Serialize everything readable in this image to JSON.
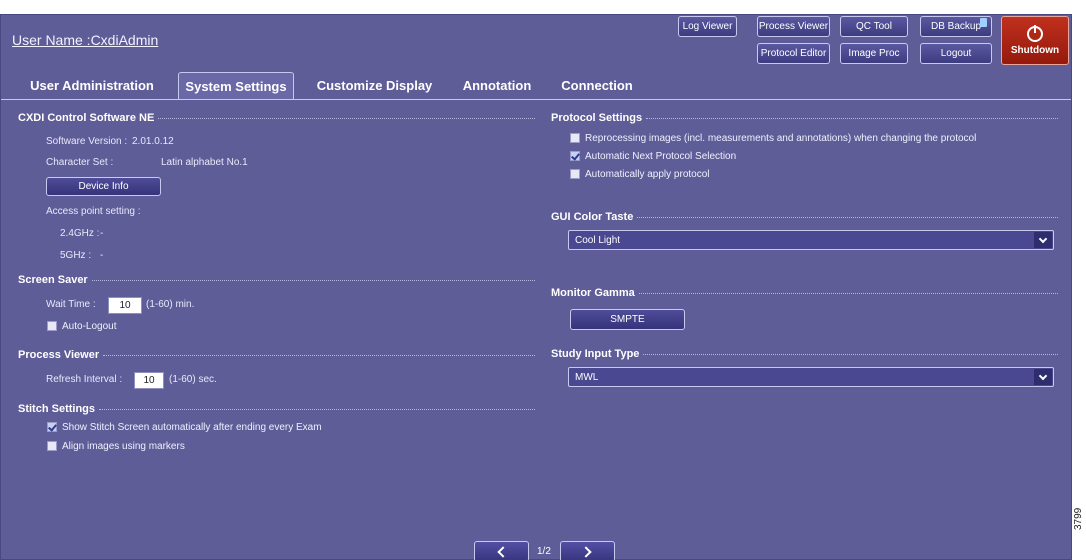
{
  "header": {
    "user_name": "User Name :CxdiAdmin",
    "buttons": {
      "log_viewer": "Log Viewer",
      "process_viewer": "Process Viewer",
      "qc_tool": "QC Tool",
      "db_backup": "DB Backup",
      "protocol_editor": "Protocol Editor",
      "image_proc": "Image Proc",
      "logout": "Logout",
      "shutdown": "Shutdown"
    }
  },
  "tabs": [
    {
      "label": "User Administration"
    },
    {
      "label": "System Settings",
      "active": true
    },
    {
      "label": "Customize Display"
    },
    {
      "label": "Annotation"
    },
    {
      "label": "Connection"
    }
  ],
  "cxdi": {
    "title": "CXDI Control Software NE",
    "software_version_label": "Software Version :",
    "software_version_value": "2.01.0.12",
    "character_set_label": "Character Set :",
    "character_set_value": "Latin alphabet No.1",
    "device_info_button": "Device Info",
    "access_point_label": "Access point setting :",
    "ghz24_label": "2.4GHz :",
    "ghz24_value": "-",
    "ghz5_label": "5GHz :",
    "ghz5_value": "-"
  },
  "screen_saver": {
    "title": "Screen Saver",
    "wait_time_label": "Wait Time :",
    "wait_time_value": "10",
    "wait_time_range": "(1-60)  min.",
    "auto_logout_label": "Auto-Logout",
    "auto_logout_checked": false
  },
  "process_viewer": {
    "title": "Process Viewer",
    "refresh_label": "Refresh Interval :",
    "refresh_value": "10",
    "refresh_range": "(1-60)  sec."
  },
  "stitch": {
    "title": "Stitch Settings",
    "show_stitch_label": "Show Stitch Screen automatically after ending every Exam",
    "show_stitch_checked": true,
    "align_label": "Align images using markers",
    "align_checked": false
  },
  "protocol": {
    "title": "Protocol Settings",
    "reprocessing_label": "Reprocessing images (incl. measurements and annotations) when changing the protocol",
    "reprocessing_checked": false,
    "auto_next_label": "Automatic Next Protocol Selection",
    "auto_next_checked": true,
    "auto_apply_label": "Automatically apply protocol",
    "auto_apply_checked": false
  },
  "gui_color": {
    "title": "GUI Color Taste",
    "selected": "Cool Light"
  },
  "monitor_gamma": {
    "title": "Monitor Gamma",
    "button": "SMPTE"
  },
  "study_input": {
    "title": "Study Input Type",
    "selected": "MWL"
  },
  "pager": {
    "text": "1/2"
  },
  "side_code": "3799",
  "colors": {
    "background": "#5f5d97",
    "shutdown": "#b0281a",
    "button_border": "#c9c8ef"
  },
  "icons": [
    "power-icon",
    "database-icon",
    "chevron-down-icon",
    "chevron-left-icon",
    "chevron-right-icon",
    "checkbox-checked-icon"
  ]
}
